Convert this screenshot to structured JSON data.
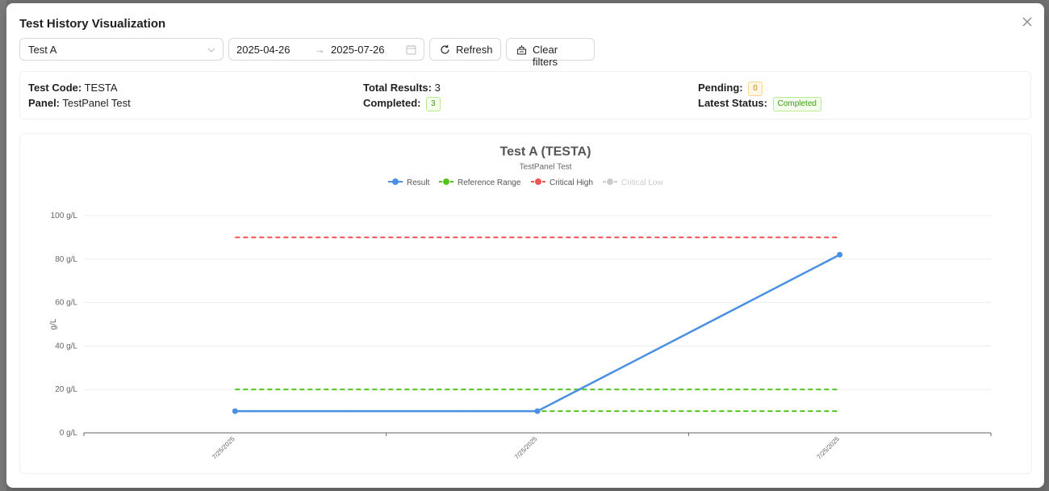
{
  "modal": {
    "title": "Test History Visualization",
    "close_icon": "close-icon"
  },
  "filters": {
    "test_select": "Test A",
    "date_from": "2025-04-26",
    "date_separator": "→",
    "date_to": "2025-07-26",
    "refresh_label": "Refresh",
    "clear_label": "Clear filters"
  },
  "summary": {
    "test_code_label": "Test Code:",
    "test_code": "TESTA",
    "panel_label": "Panel:",
    "panel": "TestPanel Test",
    "total_label": "Total Results:",
    "total": "3",
    "completed_label": "Completed:",
    "completed": "3",
    "pending_label": "Pending:",
    "pending": "0",
    "latest_status_label": "Latest Status:",
    "latest_status": "Completed"
  },
  "colors": {
    "result": "#4a90e2",
    "reference": "#52c41a",
    "critical_high": "#f05454",
    "critical_low_disabled": "#cccccc"
  },
  "chart_data": {
    "type": "line",
    "title": "Test A (TESTA)",
    "subtitle": "TestPanel Test",
    "ylabel": "g/L",
    "xlabel": "",
    "ylim": [
      0,
      100
    ],
    "yticks": [
      "0 g/L",
      "20 g/L",
      "40 g/L",
      "60 g/L",
      "80 g/L",
      "100 g/L"
    ],
    "ytick_values": [
      0,
      20,
      40,
      60,
      80,
      100
    ],
    "categories": [
      "7/25/2025",
      "7/25/2025",
      "7/25/2025"
    ],
    "legend_position": "top-center",
    "grid": true,
    "series": [
      {
        "name": "Result",
        "values": [
          10,
          10,
          82
        ],
        "style": "solid"
      },
      {
        "name": "Reference Range",
        "values": [
          20,
          20,
          20
        ],
        "style": "dashed",
        "lower": [
          10,
          10,
          10
        ]
      },
      {
        "name": "Critical High",
        "values": [
          90,
          90,
          90
        ],
        "style": "dashed"
      },
      {
        "name": "Critical Low",
        "values": [],
        "style": "dashed",
        "hidden": true
      }
    ]
  }
}
